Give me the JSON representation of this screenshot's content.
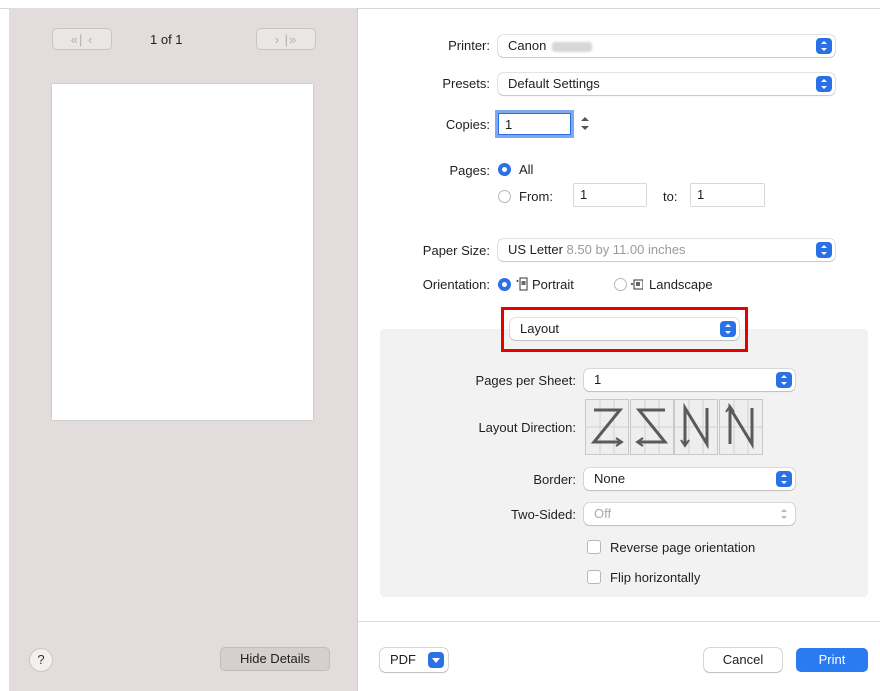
{
  "preview": {
    "first_prev_label": "«| ‹",
    "page_count": "1 of 1",
    "next_last_label": "› |»",
    "help_label": "?",
    "hide_details_label": "Hide Details"
  },
  "printer": {
    "label": "Printer:",
    "value": "Canon"
  },
  "presets": {
    "label": "Presets:",
    "value": "Default Settings"
  },
  "copies": {
    "label": "Copies:",
    "value": "1"
  },
  "pages": {
    "label": "Pages:",
    "all_label": "All",
    "from_label": "From:",
    "from_value": "1",
    "to_label": "to:",
    "to_value": "1"
  },
  "paper_size": {
    "label": "Paper Size:",
    "value": "US Letter",
    "detail": "8.50 by 11.00 inches"
  },
  "orientation": {
    "label": "Orientation:",
    "portrait_label": "Portrait",
    "landscape_label": "Landscape"
  },
  "section_popup": {
    "value": "Layout"
  },
  "layout": {
    "pages_per_sheet_label": "Pages per Sheet:",
    "pages_per_sheet_value": "1",
    "direction_label": "Layout Direction:",
    "border_label": "Border:",
    "border_value": "None",
    "two_sided_label": "Two-Sided:",
    "two_sided_value": "Off",
    "reverse_label": "Reverse page orientation",
    "flip_label": "Flip horizontally"
  },
  "footer": {
    "pdf_label": "PDF",
    "cancel_label": "Cancel",
    "print_label": "Print"
  },
  "colors": {
    "accent": "#2a71e6",
    "highlight": "#e60000",
    "sidebar": "#e2dcdc"
  }
}
